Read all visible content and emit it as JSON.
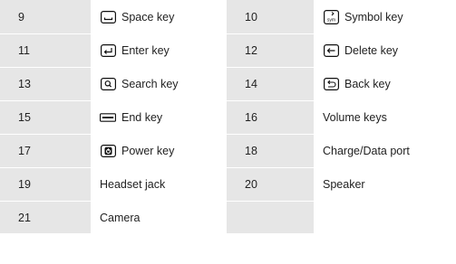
{
  "rows": [
    {
      "left": {
        "number": "9",
        "label": "Space key",
        "icon": "space-icon"
      },
      "right": {
        "number": "10",
        "label": "Symbol key",
        "icon": "symbol-icon"
      }
    },
    {
      "left": {
        "number": "11",
        "label": "Enter key",
        "icon": "enter-icon"
      },
      "right": {
        "number": "12",
        "label": "Delete key",
        "icon": "delete-icon"
      }
    },
    {
      "left": {
        "number": "13",
        "label": "Search key",
        "icon": "search-icon"
      },
      "right": {
        "number": "14",
        "label": "Back key",
        "icon": "back-icon"
      }
    },
    {
      "left": {
        "number": "15",
        "label": "End key",
        "icon": "end-icon"
      },
      "right": {
        "number": "16",
        "label": "Volume keys",
        "icon": ""
      }
    },
    {
      "left": {
        "number": "17",
        "label": "Power key",
        "icon": "power-icon"
      },
      "right": {
        "number": "18",
        "label": "Charge/Data port",
        "icon": ""
      }
    },
    {
      "left": {
        "number": "19",
        "label": "Headset jack",
        "icon": ""
      },
      "right": {
        "number": "20",
        "label": "Speaker",
        "icon": ""
      }
    },
    {
      "left": {
        "number": "21",
        "label": "Camera",
        "icon": ""
      },
      "right": {
        "number": "",
        "label": "",
        "icon": ""
      }
    }
  ],
  "colors": {
    "shade": "#e6e6e6",
    "text": "#222222",
    "icon_stroke": "#111111"
  }
}
